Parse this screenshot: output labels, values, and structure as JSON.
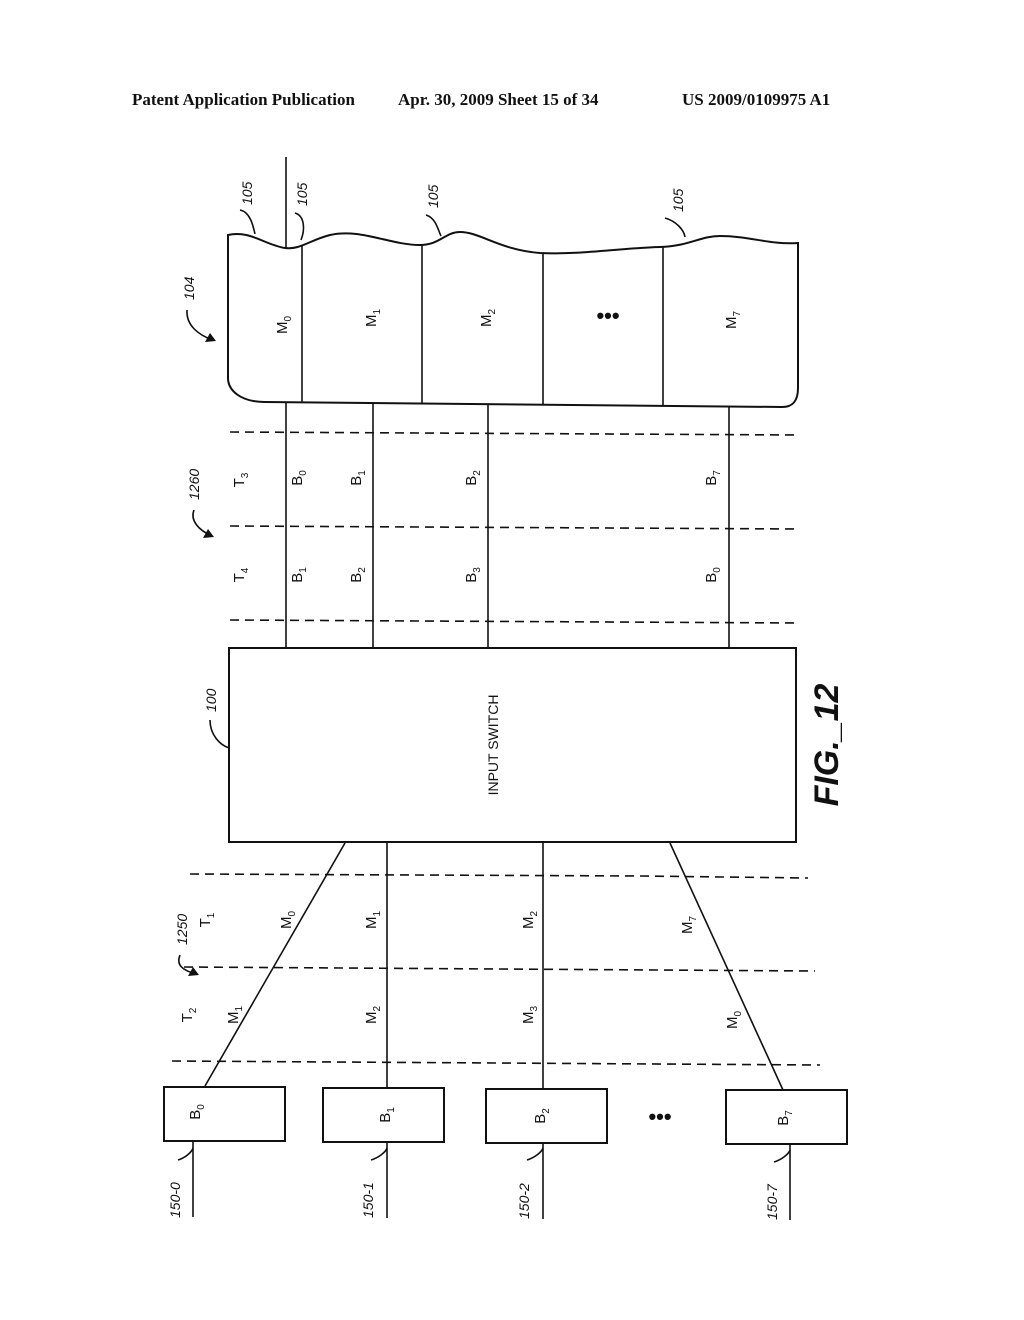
{
  "header": {
    "publication": "Patent Application Publication",
    "date_sheet": "Apr. 30, 2009  Sheet 15 of 34",
    "number": "US 2009/0109975 A1"
  },
  "figure": {
    "title": "FIG._12",
    "memory": {
      "ref": "104",
      "wave_ref": "105",
      "banks": [
        {
          "name": "M",
          "sub": "0"
        },
        {
          "name": "M",
          "sub": "1"
        },
        {
          "name": "M",
          "sub": "2"
        },
        {
          "name": "•••",
          "sub": ""
        },
        {
          "name": "M",
          "sub": "7"
        }
      ]
    },
    "output_timing": {
      "ref": "1260",
      "slots": [
        {
          "t": "T",
          "t_sub": "3",
          "labels": [
            {
              "n": "B",
              "s": "0"
            },
            {
              "n": "B",
              "s": "1"
            },
            {
              "n": "B",
              "s": "2"
            },
            {
              "n": "B",
              "s": "7"
            }
          ]
        },
        {
          "t": "T",
          "t_sub": "4",
          "labels": [
            {
              "n": "B",
              "s": "1"
            },
            {
              "n": "B",
              "s": "2"
            },
            {
              "n": "B",
              "s": "3"
            },
            {
              "n": "B",
              "s": "0"
            }
          ]
        }
      ]
    },
    "switch": {
      "ref": "100",
      "label": "INPUT SWITCH"
    },
    "input_timing": {
      "ref": "1250",
      "slots": [
        {
          "t": "T",
          "t_sub": "1",
          "labels": [
            {
              "n": "M",
              "s": "0"
            },
            {
              "n": "M",
              "s": "1"
            },
            {
              "n": "M",
              "s": "2"
            },
            {
              "n": "M",
              "s": "7"
            }
          ]
        },
        {
          "t": "T",
          "t_sub": "2",
          "labels": [
            {
              "n": "M",
              "s": "1"
            },
            {
              "n": "M",
              "s": "2"
            },
            {
              "n": "M",
              "s": "3"
            },
            {
              "n": "M",
              "s": "0"
            }
          ]
        }
      ]
    },
    "buffers": [
      {
        "name": "B",
        "sub": "0",
        "line_ref": "150-0"
      },
      {
        "name": "B",
        "sub": "1",
        "line_ref": "150-1"
      },
      {
        "name": "B",
        "sub": "2",
        "line_ref": "150-2"
      },
      {
        "name": "B",
        "sub": "7",
        "line_ref": "150-7"
      }
    ],
    "buffer_ellipsis": "•••"
  }
}
